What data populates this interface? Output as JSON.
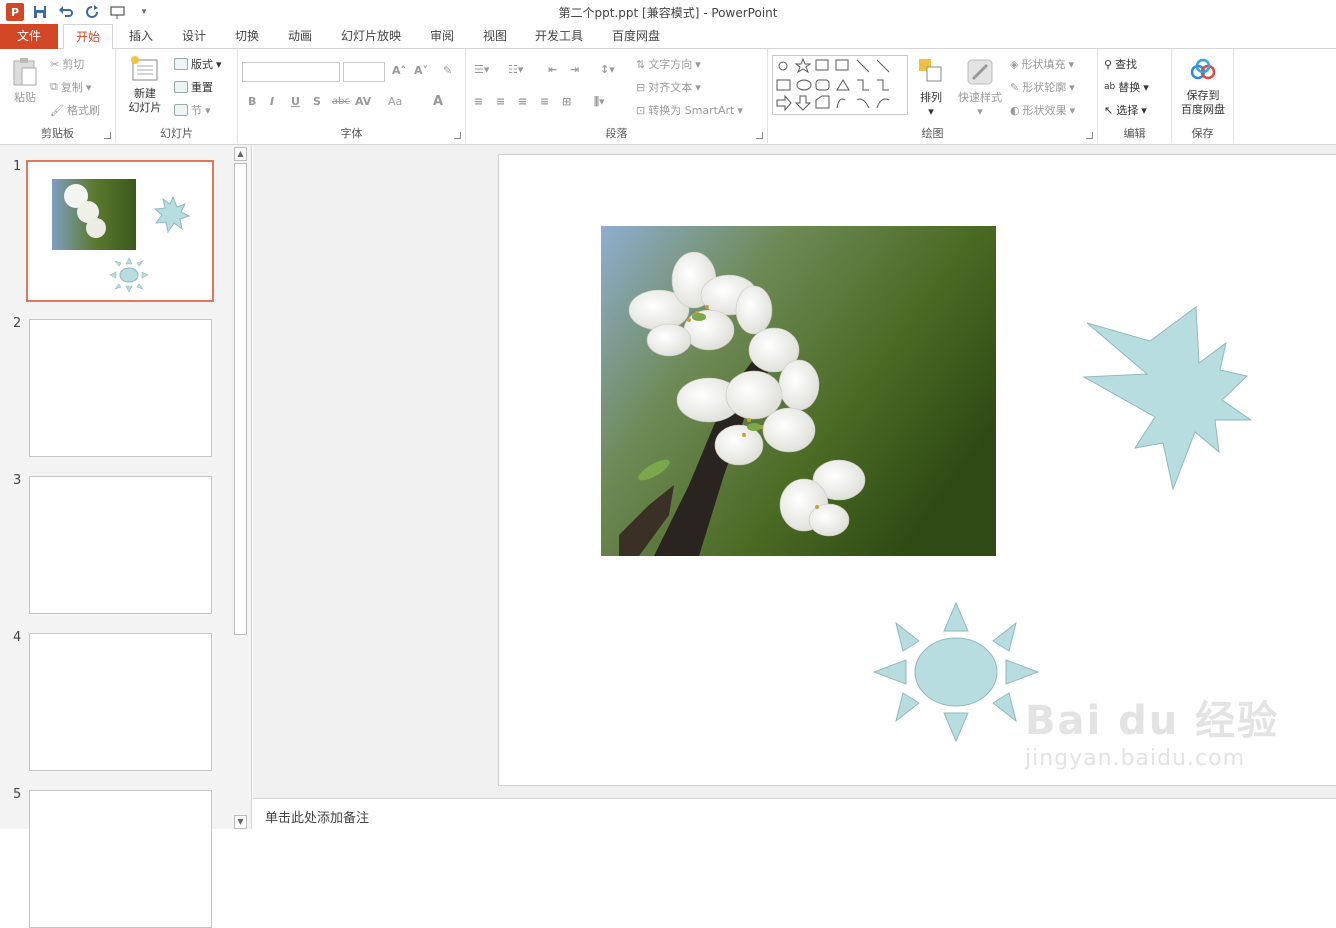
{
  "window": {
    "title": "第二个ppt.ppt [兼容模式] - PowerPoint"
  },
  "tabs": [
    "文件",
    "开始",
    "插入",
    "设计",
    "切换",
    "动画",
    "幻灯片放映",
    "审阅",
    "视图",
    "开发工具",
    "百度网盘"
  ],
  "ribbon": {
    "clipboard": {
      "paste": "粘贴",
      "cut": "剪切",
      "copy": "复制",
      "format_painter": "格式刷",
      "label": "剪贴板"
    },
    "slides": {
      "new_slide": "新建",
      "new_slide2": "幻灯片",
      "layout": "版式",
      "reset": "重置",
      "section": "节",
      "label": "幻灯片"
    },
    "font": {
      "label": "字体",
      "bold": "B",
      "italic": "I",
      "underline": "U",
      "shadow": "S",
      "strike": "abc",
      "spacing": "AV",
      "case": "Aa",
      "color": "A"
    },
    "paragraph": {
      "text_direction": "文字方向",
      "align_text": "对齐文本",
      "smartart": "转换为 SmartArt",
      "label": "段落"
    },
    "drawing": {
      "arrange": "排列",
      "quick_styles": "快速样式",
      "shape_fill": "形状填充",
      "shape_outline": "形状轮廓",
      "shape_effects": "形状效果",
      "label": "绘图"
    },
    "editing": {
      "find": "查找",
      "replace": "替换",
      "select": "选择",
      "label": "编辑"
    },
    "save": {
      "save_to": "保存到",
      "baidu": "百度网盘",
      "label": "保存"
    }
  },
  "thumbnails": [
    "1",
    "2",
    "3",
    "4",
    "5"
  ],
  "notes": {
    "placeholder": "单击此处添加备注"
  },
  "watermark": {
    "brand": "Bai du 经验",
    "url": "jingyan.baidu.com"
  },
  "colors": {
    "accent": "#d24726",
    "shape_fill": "#b7dde0",
    "shape_stroke": "#8fb9bd"
  }
}
